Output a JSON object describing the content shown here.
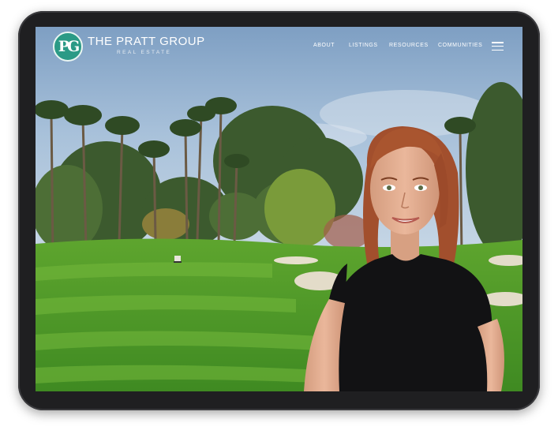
{
  "site": {
    "brand_name": "THE PRATT GROUP",
    "brand_sub": "REAL ESTATE",
    "logo_monogram": "PG",
    "accent_color": "#2b9a86"
  },
  "nav": {
    "items": [
      "ABOUT",
      "LISTINGS",
      "RESOURCES",
      "COMMUNITIES"
    ],
    "menu_icon": "hamburger-menu-icon"
  },
  "hero": {
    "scene": "golf-course-with-palm-trees",
    "subject": "agent-portrait"
  }
}
